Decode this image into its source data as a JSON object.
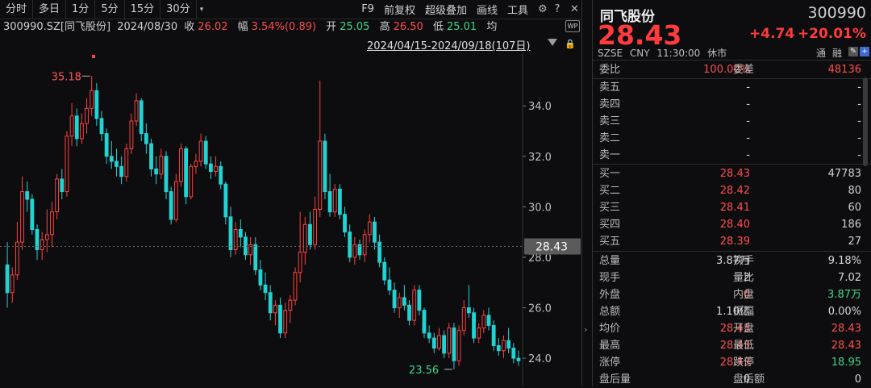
{
  "toolbar": {
    "periods": [
      "分时",
      "多日",
      "1分",
      "5分",
      "15分",
      "30分"
    ],
    "dropdown": "▾",
    "tools": [
      "F9",
      "前复权",
      "超级叠加",
      "画线",
      "工具"
    ]
  },
  "info": {
    "code_name": "300990.SZ[同飞股份]",
    "date": "2024/08/30",
    "close_label": "收",
    "close": "26.02",
    "amp_label": "幅",
    "amp": "3.54%(0.89)",
    "open_label": "开",
    "open": "25.05",
    "high_label": "高",
    "high": "26.50",
    "low_label": "低",
    "low": "25.01",
    "avg_label": "均"
  },
  "wp_badge": "WP",
  "range": "2024/04/15-2024/09/18(107日)",
  "chart_data": {
    "type": "candlestick",
    "ylim": [
      23.3,
      35.7
    ],
    "yticks": [
      "34.0",
      "32.0",
      "30.0",
      "28.0",
      "26.0",
      "24.0"
    ],
    "last_price_label": "28.43",
    "max_label": "35.18",
    "min_label": "23.56",
    "colors": {
      "up": "#ff4040",
      "down": "#22d3d3"
    },
    "ohlc": [
      [
        27.7,
        28.6,
        26.0,
        26.6
      ],
      [
        26.6,
        27.6,
        26.2,
        27.3
      ],
      [
        27.3,
        29.4,
        27.1,
        28.6
      ],
      [
        28.6,
        31.2,
        28.3,
        30.6
      ],
      [
        30.6,
        31.0,
        29.8,
        30.3
      ],
      [
        30.3,
        30.5,
        28.9,
        29.1
      ],
      [
        29.1,
        29.3,
        27.9,
        28.3
      ],
      [
        28.3,
        29.0,
        27.9,
        28.7
      ],
      [
        28.7,
        29.9,
        28.2,
        28.9
      ],
      [
        28.9,
        30.2,
        28.4,
        29.8
      ],
      [
        29.8,
        31.3,
        29.5,
        31.1
      ],
      [
        31.1,
        31.5,
        30.3,
        30.6
      ],
      [
        30.6,
        33.0,
        30.4,
        32.8
      ],
      [
        32.8,
        34.1,
        32.4,
        33.6
      ],
      [
        33.6,
        33.9,
        32.4,
        32.7
      ],
      [
        32.7,
        33.7,
        32.5,
        33.3
      ],
      [
        33.3,
        34.3,
        32.9,
        33.9
      ],
      [
        33.9,
        35.18,
        33.6,
        34.6
      ],
      [
        34.6,
        34.9,
        33.2,
        33.5
      ],
      [
        33.5,
        33.8,
        32.6,
        32.9
      ],
      [
        32.9,
        33.1,
        31.7,
        32.0
      ],
      [
        32.0,
        32.6,
        31.5,
        31.8
      ],
      [
        31.8,
        32.3,
        31.2,
        31.6
      ],
      [
        31.6,
        32.0,
        30.9,
        31.2
      ],
      [
        31.2,
        32.5,
        31.0,
        32.3
      ],
      [
        32.3,
        33.7,
        32.1,
        33.4
      ],
      [
        33.4,
        34.5,
        33.2,
        34.2
      ],
      [
        34.2,
        34.3,
        32.6,
        32.9
      ],
      [
        32.9,
        33.3,
        32.1,
        32.5
      ],
      [
        32.5,
        32.7,
        31.2,
        31.5
      ],
      [
        31.5,
        32.0,
        30.9,
        31.3
      ],
      [
        31.3,
        32.3,
        31.1,
        32.0
      ],
      [
        32.0,
        32.2,
        30.3,
        30.6
      ],
      [
        30.6,
        30.8,
        29.3,
        29.5
      ],
      [
        29.5,
        31.3,
        29.4,
        31.0
      ],
      [
        31.0,
        32.5,
        30.8,
        32.3
      ],
      [
        32.3,
        32.4,
        30.1,
        30.4
      ],
      [
        30.4,
        31.7,
        30.3,
        31.6
      ],
      [
        31.6,
        32.1,
        31.3,
        31.8
      ],
      [
        31.8,
        32.9,
        31.6,
        32.6
      ],
      [
        32.6,
        32.8,
        31.5,
        31.7
      ],
      [
        31.7,
        32.0,
        31.1,
        31.4
      ],
      [
        31.4,
        32.0,
        31.2,
        31.6
      ],
      [
        31.6,
        31.8,
        30.7,
        30.9
      ],
      [
        30.9,
        31.0,
        29.3,
        29.6
      ],
      [
        29.6,
        30.0,
        28.0,
        28.3
      ],
      [
        28.3,
        29.4,
        28.1,
        29.1
      ],
      [
        29.1,
        29.5,
        28.4,
        28.8
      ],
      [
        28.8,
        29.0,
        27.9,
        28.1
      ],
      [
        28.1,
        28.8,
        27.7,
        28.5
      ],
      [
        28.5,
        28.8,
        27.3,
        27.5
      ],
      [
        27.5,
        27.9,
        26.7,
        26.9
      ],
      [
        26.9,
        27.4,
        26.3,
        26.6
      ],
      [
        26.6,
        26.9,
        25.5,
        25.8
      ],
      [
        25.8,
        26.3,
        25.3,
        26.1
      ],
      [
        26.1,
        26.4,
        24.8,
        25.0
      ],
      [
        25.0,
        26.2,
        24.8,
        25.9
      ],
      [
        25.9,
        26.5,
        25.4,
        26.3
      ],
      [
        26.3,
        27.6,
        26.1,
        27.4
      ],
      [
        27.4,
        29.8,
        27.0,
        28.2
      ],
      [
        28.2,
        29.6,
        27.7,
        29.3
      ],
      [
        29.3,
        29.8,
        28.3,
        28.5
      ],
      [
        28.5,
        30.4,
        28.3,
        29.9
      ],
      [
        29.9,
        35.0,
        29.6,
        32.6
      ],
      [
        32.6,
        32.9,
        30.3,
        30.6
      ],
      [
        30.6,
        31.3,
        29.6,
        29.8
      ],
      [
        29.8,
        30.9,
        29.6,
        30.7
      ],
      [
        30.7,
        30.9,
        29.5,
        29.7
      ],
      [
        29.7,
        30.0,
        28.8,
        29.0
      ],
      [
        29.0,
        29.3,
        27.8,
        28.0
      ],
      [
        28.0,
        28.8,
        27.7,
        28.5
      ],
      [
        28.5,
        28.7,
        27.9,
        28.1
      ],
      [
        28.1,
        29.1,
        27.8,
        28.9
      ],
      [
        28.9,
        29.7,
        28.6,
        29.4
      ],
      [
        29.4,
        29.6,
        28.3,
        28.6
      ],
      [
        28.6,
        28.9,
        27.6,
        27.8
      ],
      [
        27.8,
        28.0,
        26.9,
        27.1
      ],
      [
        27.1,
        27.6,
        26.5,
        26.7
      ],
      [
        26.7,
        27.0,
        25.8,
        26.0
      ],
      [
        26.0,
        26.6,
        25.6,
        26.4
      ],
      [
        26.4,
        26.9,
        25.9,
        26.1
      ],
      [
        26.1,
        26.3,
        25.3,
        25.5
      ],
      [
        25.5,
        26.9,
        25.3,
        26.7
      ],
      [
        26.7,
        26.9,
        25.7,
        25.9
      ],
      [
        25.9,
        26.0,
        24.8,
        25.0
      ],
      [
        25.0,
        25.3,
        24.6,
        24.8
      ],
      [
        24.8,
        25.0,
        24.2,
        24.4
      ],
      [
        24.4,
        25.2,
        24.3,
        24.9
      ],
      [
        24.9,
        25.1,
        24.0,
        24.2
      ],
      [
        24.2,
        25.4,
        24.0,
        25.2
      ],
      [
        25.2,
        25.4,
        23.56,
        23.9
      ],
      [
        23.9,
        25.3,
        23.7,
        25.1
      ],
      [
        25.1,
        26.3,
        24.9,
        26.0
      ],
      [
        26.0,
        26.9,
        25.6,
        25.8
      ],
      [
        25.8,
        26.0,
        24.6,
        24.8
      ],
      [
        24.8,
        25.4,
        24.6,
        25.2
      ],
      [
        25.2,
        25.9,
        25.0,
        25.7
      ],
      [
        25.7,
        26.0,
        25.1,
        25.3
      ],
      [
        25.3,
        25.5,
        24.3,
        24.5
      ],
      [
        24.5,
        24.8,
        24.1,
        24.3
      ],
      [
        24.3,
        24.9,
        24.0,
        24.7
      ],
      [
        24.7,
        25.2,
        24.2,
        24.4
      ],
      [
        24.4,
        24.6,
        23.8,
        24.0
      ],
      [
        24.0,
        24.3,
        23.7,
        23.9
      ]
    ]
  },
  "right": {
    "name": "同飞股份",
    "code": "300990",
    "price": "28.43",
    "change": "+4.74",
    "change_pct": "+20.01%",
    "exchange": "SZSE",
    "currency": "CNY",
    "time": "11:30:00",
    "status": "休市",
    "tong": "通",
    "rong": "融",
    "weibi_label": "委比",
    "weibi": "100.00%",
    "weicha_label": "委差",
    "weicha": "48136",
    "asks": [
      {
        "label": "卖五",
        "price": "-",
        "vol": "-"
      },
      {
        "label": "卖四",
        "price": "-",
        "vol": "-"
      },
      {
        "label": "卖三",
        "price": "-",
        "vol": "-"
      },
      {
        "label": "卖二",
        "price": "-",
        "vol": "-"
      },
      {
        "label": "卖一",
        "price": "-",
        "vol": "-"
      }
    ],
    "bids": [
      {
        "label": "买一",
        "price": "28.43",
        "vol": "47783"
      },
      {
        "label": "买二",
        "price": "28.42",
        "vol": "80"
      },
      {
        "label": "买三",
        "price": "28.41",
        "vol": "60"
      },
      {
        "label": "买四",
        "price": "28.40",
        "vol": "186"
      },
      {
        "label": "买五",
        "price": "28.39",
        "vol": "27"
      }
    ],
    "stats": [
      {
        "l1": "总量",
        "v1": "3.87万",
        "c1": "wht",
        "l2": "换手",
        "v2": "9.18%",
        "c2": "wht"
      },
      {
        "l1": "现手",
        "v1": "2",
        "c1": "wht",
        "l2": "量比",
        "v2": "7.02",
        "c2": "wht"
      },
      {
        "l1": "外盘",
        "v1": "0",
        "c1": "red",
        "l2": "内盘",
        "v2": "3.87万",
        "c2": "grn"
      },
      {
        "l1": "总额",
        "v1": "1.10亿",
        "c1": "wht",
        "l2": "振幅",
        "v2": "0.00%",
        "c2": "wht"
      },
      {
        "l1": "均价",
        "v1": "28.43",
        "c1": "red",
        "l2": "开盘",
        "v2": "28.43",
        "c2": "red"
      },
      {
        "l1": "最高",
        "v1": "28.43",
        "c1": "red",
        "l2": "最低",
        "v2": "28.43",
        "c2": "red"
      },
      {
        "l1": "涨停",
        "v1": "28.43",
        "c1": "red",
        "l2": "跌停",
        "v2": "18.95",
        "c2": "grn"
      },
      {
        "l1": "盘后量",
        "v1": "0",
        "c1": "wht",
        "l2": "盘后额",
        "v2": "0",
        "c2": "wht"
      }
    ]
  }
}
